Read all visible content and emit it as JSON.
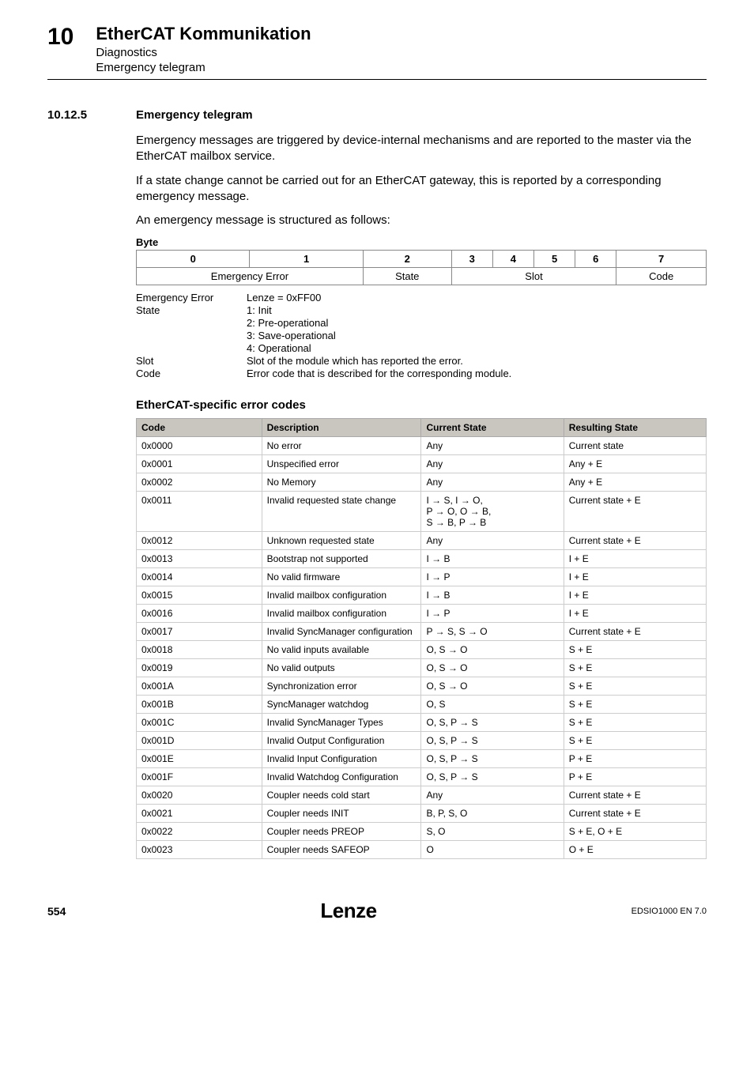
{
  "header": {
    "chapter_num": "10",
    "title": "EtherCAT Kommunikation",
    "sub1": "Diagnostics",
    "sub2": "Emergency telegram"
  },
  "section": {
    "num": "10.12.5",
    "title": "Emergency telegram",
    "p1": "Emergency messages are triggered by device-internal mechanisms and are reported to the master via the EtherCAT mailbox service.",
    "p2": "If a state change cannot be carried out for an EtherCAT gateway, this is reported by a corresponding emergency message.",
    "p3": "An emergency message is structured as follows:"
  },
  "byte": {
    "label": "Byte",
    "h0": "0",
    "h1": "1",
    "h2": "2",
    "h3": "3",
    "h4": "4",
    "h5": "5",
    "h6": "6",
    "h7": "7",
    "r0": "Emergency Error",
    "r1": "State",
    "r2": "Slot",
    "r3": "Code"
  },
  "defs": {
    "t_err": "Emergency Error",
    "v_err": "Lenze = 0xFF00",
    "t_state": "State",
    "v_state1": "1: Init",
    "v_state2": "2: Pre-operational",
    "v_state3": "3: Save-operational",
    "v_state4": "4: Operational",
    "t_slot": "Slot",
    "v_slot": "Slot of the module which has reported the error.",
    "t_code": "Code",
    "v_code": "Error code that is described for the corresponding module."
  },
  "codes_title": "EtherCAT-specific error codes",
  "codes_headers": {
    "code": "Code",
    "desc": "Description",
    "cur": "Current State",
    "res": "Resulting State"
  },
  "codes": [
    {
      "code": "0x0000",
      "desc": "No error",
      "cur": "Any",
      "res": "Current state"
    },
    {
      "code": "0x0001",
      "desc": "Unspecified error",
      "cur": "Any",
      "res": "Any + E"
    },
    {
      "code": "0x0002",
      "desc": "No Memory",
      "cur": "Any",
      "res": "Any + E"
    },
    {
      "code": "0x0011",
      "desc": "Invalid requested state change",
      "cur": "I → S, I → O,\nP → O, O → B,\nS → B, P → B",
      "res": "Current state + E"
    },
    {
      "code": "0x0012",
      "desc": "Unknown requested state",
      "cur": "Any",
      "res": "Current state + E"
    },
    {
      "code": "0x0013",
      "desc": "Bootstrap not supported",
      "cur": "I → B",
      "res": "I + E"
    },
    {
      "code": "0x0014",
      "desc": "No valid firmware",
      "cur": "I → P",
      "res": "I + E"
    },
    {
      "code": "0x0015",
      "desc": "Invalid mailbox configuration",
      "cur": "I → B",
      "res": "I + E"
    },
    {
      "code": "0x0016",
      "desc": "Invalid mailbox configuration",
      "cur": "I → P",
      "res": "I + E"
    },
    {
      "code": "0x0017",
      "desc": "Invalid SyncManager configuration",
      "cur": "P → S, S → O",
      "res": "Current state + E"
    },
    {
      "code": "0x0018",
      "desc": "No valid inputs available",
      "cur": "O, S → O",
      "res": "S + E"
    },
    {
      "code": "0x0019",
      "desc": "No valid outputs",
      "cur": "O, S → O",
      "res": "S + E"
    },
    {
      "code": "0x001A",
      "desc": "Synchronization error",
      "cur": "O, S → O",
      "res": "S + E"
    },
    {
      "code": "0x001B",
      "desc": "SyncManager watchdog",
      "cur": "O, S",
      "res": "S + E"
    },
    {
      "code": "0x001C",
      "desc": "Invalid SyncManager Types",
      "cur": "O, S, P → S",
      "res": "S + E"
    },
    {
      "code": "0x001D",
      "desc": "Invalid Output Configuration",
      "cur": "O, S, P → S",
      "res": "S + E"
    },
    {
      "code": "0x001E",
      "desc": "Invalid Input Configuration",
      "cur": "O, S, P → S",
      "res": "P + E"
    },
    {
      "code": "0x001F",
      "desc": "Invalid Watchdog Configuration",
      "cur": "O, S, P → S",
      "res": "P + E"
    },
    {
      "code": "0x0020",
      "desc": "Coupler needs cold start",
      "cur": "Any",
      "res": "Current state + E"
    },
    {
      "code": "0x0021",
      "desc": "Coupler needs INIT",
      "cur": "B, P, S, O",
      "res": "Current state + E"
    },
    {
      "code": "0x0022",
      "desc": "Coupler needs PREOP",
      "cur": "S, O",
      "res": "S + E, O + E"
    },
    {
      "code": "0x0023",
      "desc": "Coupler needs SAFEOP",
      "cur": "O",
      "res": "O + E"
    }
  ],
  "footer": {
    "page": "554",
    "brand": "Lenze",
    "docid": "EDSIO1000 EN 7.0"
  }
}
